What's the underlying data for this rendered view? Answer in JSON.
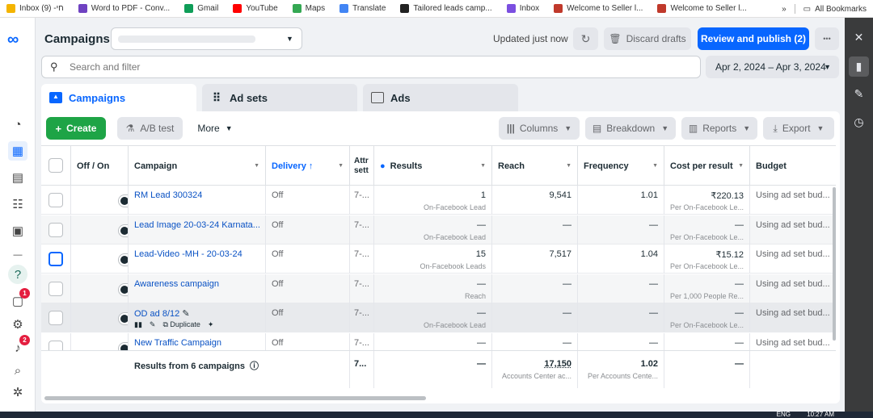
{
  "bookmarks": [
    {
      "label": "Inbox (9) -חי",
      "color": "#f4b400"
    },
    {
      "label": "Word to PDF - Conv...",
      "color": "#6f42c1"
    },
    {
      "label": "Gmail",
      "color": "#0f9d58"
    },
    {
      "label": "YouTube",
      "color": "#ff0000"
    },
    {
      "label": "Maps",
      "color": "#34a853"
    },
    {
      "label": "Translate",
      "color": "#4285f4"
    },
    {
      "label": "Tailored leads camp...",
      "color": "#222222"
    },
    {
      "label": "Inbox",
      "color": "#7b4fe0"
    },
    {
      "label": "Welcome to Seller l...",
      "color": "#c0392b"
    },
    {
      "label": "Welcome to Seller l...",
      "color": "#c0392b"
    }
  ],
  "bookmarks_more": "»",
  "all_bookmarks": "All Bookmarks",
  "header": {
    "title": "Campaigns",
    "updated": "Updated just now",
    "discard": "Discard drafts",
    "review": "Review and publish (2)",
    "more": "•••"
  },
  "search": {
    "placeholder": "Search and filter"
  },
  "date_range": "Apr 2, 2024 – Apr 3, 2024",
  "tabs": [
    {
      "label": "Campaigns"
    },
    {
      "label": "Ad sets"
    },
    {
      "label": "Ads"
    }
  ],
  "toolbar": {
    "create": "Create",
    "ab_test": "A/B test",
    "more": "More",
    "columns": "Columns",
    "breakdown": "Breakdown",
    "reports": "Reports",
    "export": "Export"
  },
  "columns": {
    "offon": "Off / On",
    "campaign": "Campaign",
    "delivery": "Delivery ↑",
    "attr": "Attr sett",
    "results": "Results",
    "reach": "Reach",
    "frequency": "Frequency",
    "cpr": "Cost per result",
    "budget": "Budget"
  },
  "rows": [
    {
      "name": "RM Lead 300324",
      "delivery": "Off",
      "attr": "7-...",
      "results": "1",
      "results_sub": "On-Facebook Lead",
      "reach": "9,541",
      "frequency": "1.01",
      "cpr": "₹220.13",
      "cpr_sub": "Per On-Facebook Le...",
      "budget": "Using ad set bud..."
    },
    {
      "name": "Lead Image 20-03-24 Karnata...",
      "delivery": "Off",
      "attr": "7-...",
      "results": "—",
      "results_sub": "On-Facebook Lead",
      "reach": "—",
      "frequency": "—",
      "cpr": "—",
      "cpr_sub": "Per On-Facebook Le...",
      "budget": "Using ad set bud..."
    },
    {
      "name": "Lead-Video -MH - 20-03-24",
      "delivery": "Off",
      "attr": "7-...",
      "results": "15",
      "results_sub": "On-Facebook Leads",
      "reach": "7,517",
      "frequency": "1.04",
      "cpr": "₹15.12",
      "cpr_sub": "Per On-Facebook Le...",
      "budget": "Using ad set bud..."
    },
    {
      "name": "Awareness campaign",
      "delivery": "Off",
      "attr": "7-...",
      "results": "—",
      "results_sub": "Reach",
      "reach": "—",
      "frequency": "—",
      "cpr": "—",
      "cpr_sub": "Per 1,000 People Re...",
      "budget": "Using ad set bud..."
    },
    {
      "name": "OD ad 8/12",
      "delivery": "Off",
      "attr": "7-...",
      "results": "—",
      "results_sub": "On-Facebook Lead",
      "reach": "—",
      "frequency": "—",
      "cpr": "—",
      "cpr_sub": "Per On-Facebook Le...",
      "budget": "Using ad set bud...",
      "duplicate": "Duplicate"
    },
    {
      "name": "New Traffic Campaign",
      "delivery": "Off",
      "attr": "7-...",
      "results": "—",
      "results_sub": "",
      "reach": "—",
      "frequency": "—",
      "cpr": "—",
      "cpr_sub": "",
      "budget": "Using ad set bud..."
    }
  ],
  "totals": {
    "label": "Results from 6 campaigns",
    "attr": "7...",
    "results": "—",
    "reach": "17,150",
    "reach_sub": "Accounts Center ac...",
    "frequency": "1.02",
    "frequency_sub": "Per Accounts Cente...",
    "cpr": "—"
  },
  "nav_badges": {
    "notifications": "1",
    "alerts": "2"
  },
  "taskbar": {
    "lang": "ENG",
    "time": "10:27 AM"
  },
  "colors": {
    "primary": "#0866ff",
    "create": "#1ea446",
    "link": "#0a52c4"
  }
}
